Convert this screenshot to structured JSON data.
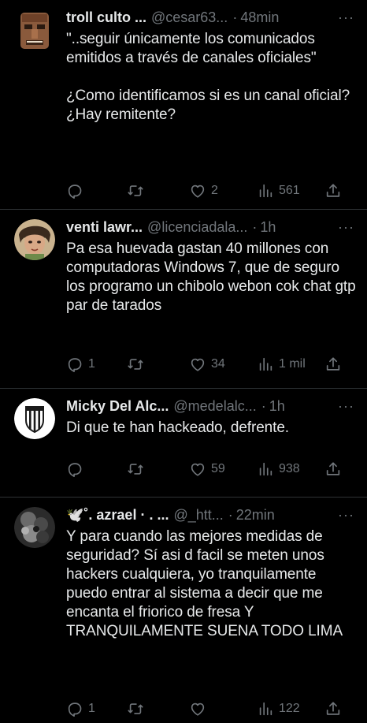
{
  "colors": {
    "background": "#000000",
    "text_primary": "#e7e9ea",
    "text_secondary": "#71767b",
    "divider": "#2f3336"
  },
  "more_label": "···",
  "dot": "·",
  "tweets": [
    {
      "name": "troll culto ...",
      "handle": "@cesar63...",
      "time": "48min",
      "text": "\"..seguir únicamente los comunicados emitidos a través de canales oficiales\"\n\n¿Como identificamos si es un canal oficial? ¿Hay remitente?",
      "replies": "",
      "retweets": "",
      "likes": "2",
      "views": "561",
      "avatar_icon": "moai-avatar-icon"
    },
    {
      "name": "venti lawr...",
      "handle": "@licenciadala...",
      "time": "1h",
      "text": "Pa esa huevada gastan 40 millones con computadoras Windows 7, que de seguro los programo un chibolo webon cok chat gtp par de tarados",
      "replies": "1",
      "retweets": "",
      "likes": "34",
      "views": "1 mil",
      "avatar_icon": "anime-character-avatar-icon"
    },
    {
      "name": "Micky Del Alc...",
      "handle": "@medelalc...",
      "time": "1h",
      "text": "Di que te han hackeado, defrente.",
      "replies": "",
      "retweets": "",
      "likes": "59",
      "views": "938",
      "avatar_icon": "club-crest-avatar-icon"
    },
    {
      "name": "🕊️˚. azrael · . ...",
      "handle": "@_htt...",
      "time": "22min",
      "text": "Y para cuando las mejores medidas de seguridad? Sí asi d facil se meten unos hackers cualquiera, yo tranquilamente puedo entrar al sistema a decir que me encanta el friorico de fresa Y TRANQUILAMENTE SUENA TODO LIMA",
      "replies": "1",
      "retweets": "",
      "likes": "",
      "views": "122",
      "avatar_icon": "dark-texture-avatar-icon"
    }
  ]
}
